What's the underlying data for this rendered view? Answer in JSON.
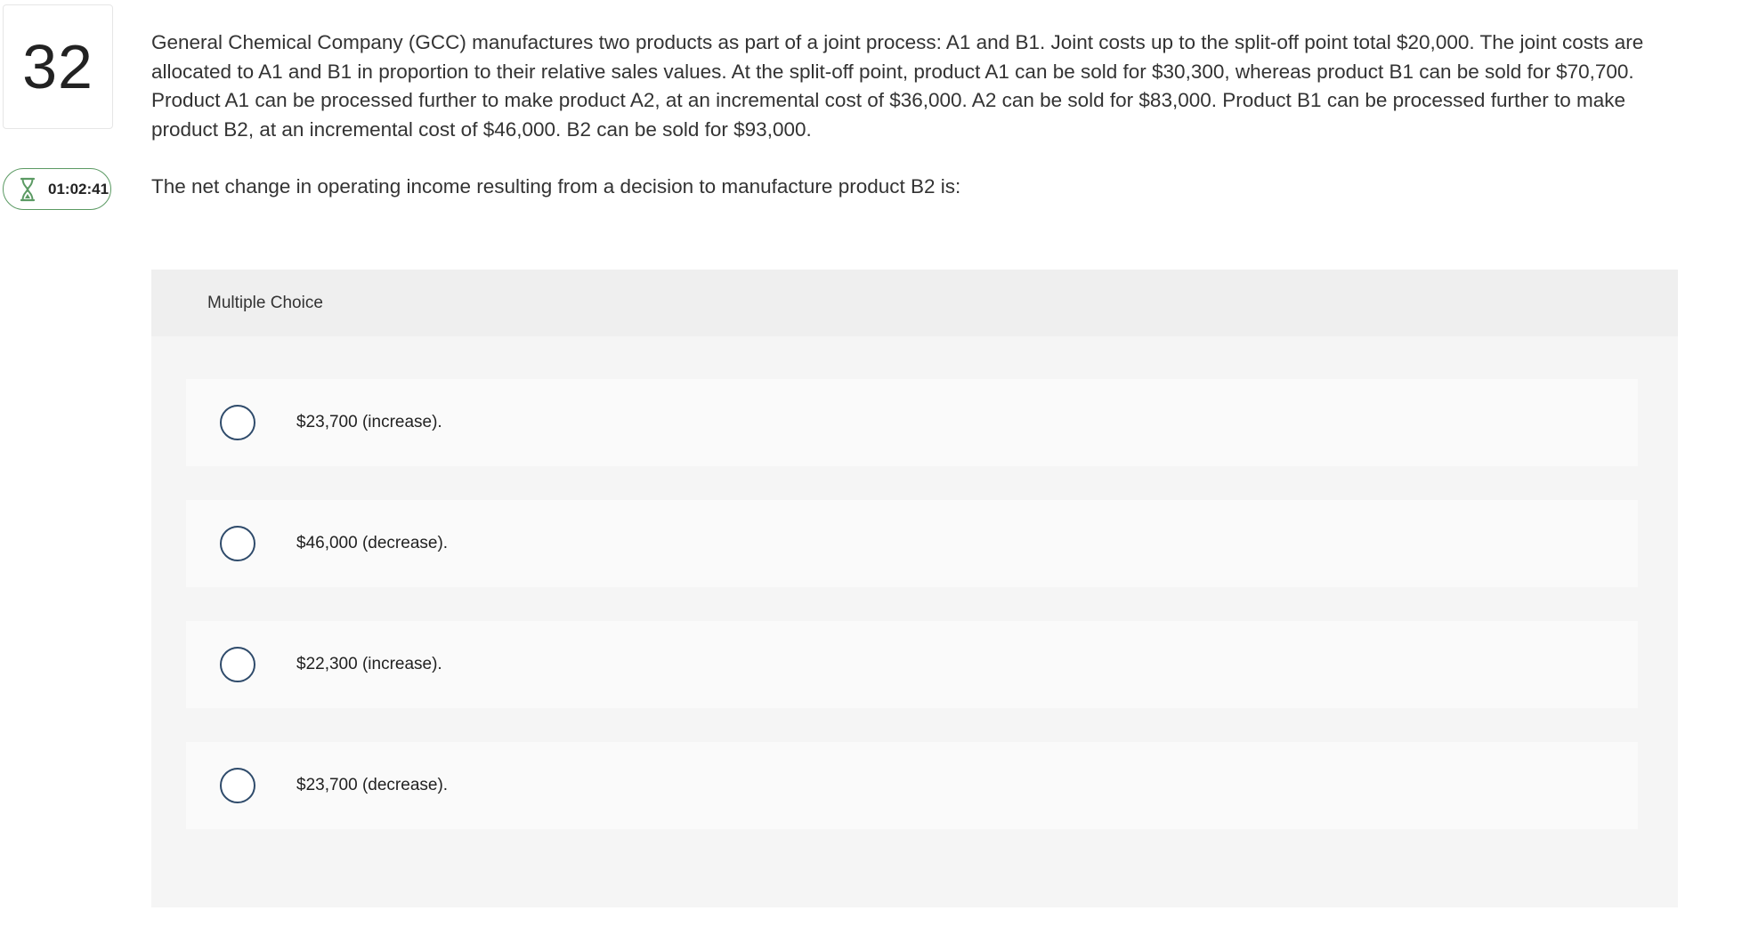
{
  "question_number": "32",
  "timer": {
    "icon": "hourglass-icon",
    "time": "01:02:41",
    "color": "#5b9a63"
  },
  "question": {
    "text": "General Chemical Company (GCC) manufactures two products as part of a joint process: A1 and B1. Joint costs up to the split-off point total $20,000. The joint costs are allocated to A1 and B1 in proportion to their relative sales values. At the split-off point, product A1 can be sold for $30,300, whereas product B1 can be sold for $70,700. Product A1 can be processed further to make product A2, at an incremental cost of $36,000. A2 can be sold for $83,000. Product B1 can be processed further to make product B2, at an incremental cost of $46,000. B2 can be sold for $93,000.",
    "prompt": "The net change in operating income resulting from a decision to manufacture product B2 is:"
  },
  "multiple_choice": {
    "header": "Multiple Choice",
    "options": [
      {
        "label": "$23,700 (increase)."
      },
      {
        "label": "$46,000 (decrease)."
      },
      {
        "label": "$22,300 (increase)."
      },
      {
        "label": "$23,700 (decrease)."
      }
    ]
  },
  "colors": {
    "radio_border": "#2f4b6b",
    "panel_background": "#f2f2f2",
    "option_background": "#fafafa"
  }
}
